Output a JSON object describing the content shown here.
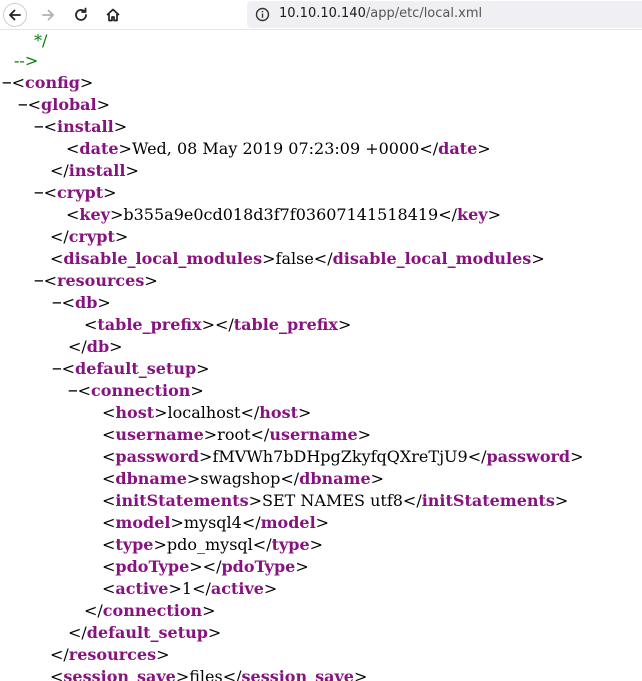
{
  "browser": {
    "url_host": "10.10.10.140",
    "url_path": "/app/etc/local.xml"
  },
  "xml": {
    "comment_end_1": "*/",
    "comment_end_2": "-->",
    "config": "config",
    "global": "global",
    "install": "install",
    "date": {
      "tag": "date",
      "value": "Wed, 08 May 2019 07:23:09 +0000"
    },
    "crypt": "crypt",
    "key": {
      "tag": "key",
      "value": "b355a9e0cd018d3f7f03607141518419"
    },
    "disable_local_modules": {
      "tag": "disable_local_modules",
      "value": "false"
    },
    "resources": "resources",
    "db": "db",
    "table_prefix": {
      "tag": "table_prefix",
      "value": ""
    },
    "default_setup": "default_setup",
    "connection": "connection",
    "host": {
      "tag": "host",
      "value": "localhost"
    },
    "username": {
      "tag": "username",
      "value": "root"
    },
    "password": {
      "tag": "password",
      "value": "fMVWh7bDHpgZkyfqQXreTjU9"
    },
    "dbname": {
      "tag": "dbname",
      "value": "swagshop"
    },
    "initStatements": {
      "tag": "initStatements",
      "value": "SET NAMES utf8"
    },
    "model": {
      "tag": "model",
      "value": "mysql4"
    },
    "type": {
      "tag": "type",
      "value": "pdo_mysql"
    },
    "pdoType": {
      "tag": "pdoType",
      "value": ""
    },
    "active": {
      "tag": "active",
      "value": "1"
    },
    "session_save": {
      "tag": "session_save",
      "value": "files"
    }
  },
  "toggle_symbol": "−",
  "colors": {
    "tag": "#881280",
    "comment": "#007a00",
    "text": "#000000"
  },
  "icons": [
    "back-arrow-icon",
    "forward-arrow-icon",
    "reload-icon",
    "home-icon",
    "site-info-icon"
  ]
}
